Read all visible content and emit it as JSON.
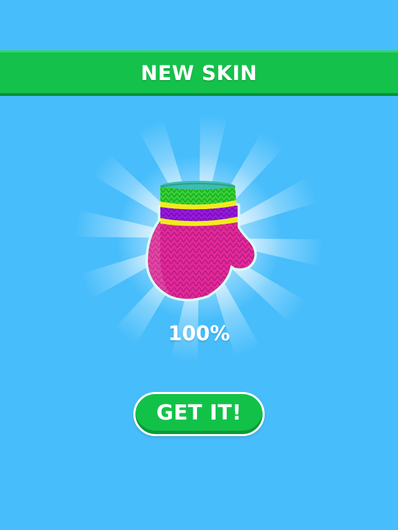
{
  "banner": {
    "title": "NEW SKIN"
  },
  "reward": {
    "item": "knitted-mitten-icon",
    "progress_text": "100%",
    "progress_value": 1.0
  },
  "actions": {
    "get_label": "GET IT!"
  },
  "colors": {
    "background": "#47bdfb",
    "banner": "#14c14a",
    "button": "#12c248",
    "mitten_body": "#e2299b",
    "cuff_green": "#34d333",
    "cuff_purple": "#9a18e0",
    "cuff_yellow": "#f1ea1f",
    "cuff_teal": "#3cbdb0"
  }
}
